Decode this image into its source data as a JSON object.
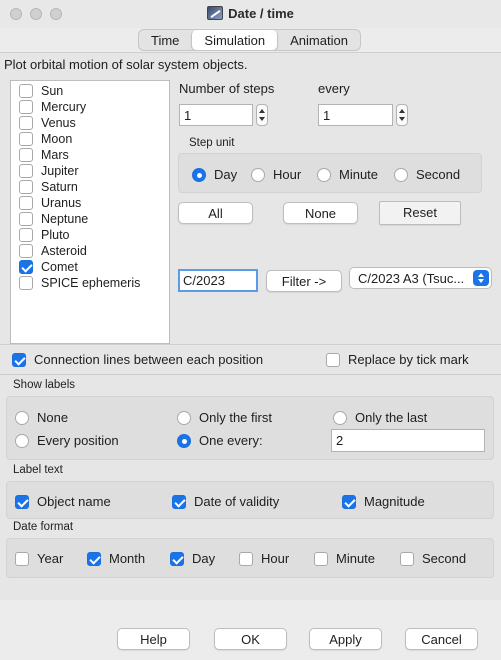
{
  "window": {
    "title": "Date / time",
    "app_icon": "telescope-icon"
  },
  "tabs": [
    {
      "label": "Time",
      "active": false
    },
    {
      "label": "Simulation",
      "active": true
    },
    {
      "label": "Animation",
      "active": false
    }
  ],
  "description": "Plot orbital motion of solar system objects.",
  "objects": [
    {
      "label": "Sun",
      "checked": false
    },
    {
      "label": "Mercury",
      "checked": false
    },
    {
      "label": "Venus",
      "checked": false
    },
    {
      "label": "Moon",
      "checked": false
    },
    {
      "label": "Mars",
      "checked": false
    },
    {
      "label": "Jupiter",
      "checked": false
    },
    {
      "label": "Saturn",
      "checked": false
    },
    {
      "label": "Uranus",
      "checked": false
    },
    {
      "label": "Neptune",
      "checked": false
    },
    {
      "label": "Pluto",
      "checked": false
    },
    {
      "label": "Asteroid",
      "checked": false
    },
    {
      "label": "Comet",
      "checked": true
    },
    {
      "label": "SPICE ephemeris",
      "checked": false
    }
  ],
  "steps": {
    "number_label": "Number of steps",
    "number_value": "1",
    "every_label": "every",
    "every_value": "1"
  },
  "step_unit": {
    "title": "Step unit",
    "options": [
      {
        "label": "Day",
        "selected": true
      },
      {
        "label": "Hour",
        "selected": false
      },
      {
        "label": "Minute",
        "selected": false
      },
      {
        "label": "Second",
        "selected": false
      }
    ]
  },
  "object_buttons": {
    "all": "All",
    "none": "None",
    "reset": "Reset"
  },
  "filter": {
    "value": "C/2023",
    "button": "Filter ->",
    "selected": "C/2023 A3 (Tsuc..."
  },
  "connection_lines": {
    "label": "Connection lines between each position",
    "checked": true
  },
  "replace_tick": {
    "label": "Replace by tick mark",
    "checked": false
  },
  "show_labels": {
    "title": "Show labels",
    "options": [
      {
        "label": "None",
        "selected": false
      },
      {
        "label": "Only the first",
        "selected": false
      },
      {
        "label": "Only the last",
        "selected": false
      },
      {
        "label": "Every position",
        "selected": false
      },
      {
        "label": "One every:",
        "selected": true
      }
    ],
    "one_every_value": "2"
  },
  "label_text": {
    "title": "Label text",
    "items": [
      {
        "label": "Object name",
        "checked": true
      },
      {
        "label": "Date of validity",
        "checked": true
      },
      {
        "label": "Magnitude",
        "checked": true
      }
    ]
  },
  "date_format": {
    "title": "Date format",
    "items": [
      {
        "label": "Year",
        "checked": false
      },
      {
        "label": "Month",
        "checked": true
      },
      {
        "label": "Day",
        "checked": true
      },
      {
        "label": "Hour",
        "checked": false
      },
      {
        "label": "Minute",
        "checked": false
      },
      {
        "label": "Second",
        "checked": false
      }
    ]
  },
  "footer_buttons": {
    "help": "Help",
    "ok": "OK",
    "apply": "Apply",
    "cancel": "Cancel"
  },
  "colors": {
    "accent": "#1a73e8",
    "focus_ring": "#5b9be8"
  }
}
